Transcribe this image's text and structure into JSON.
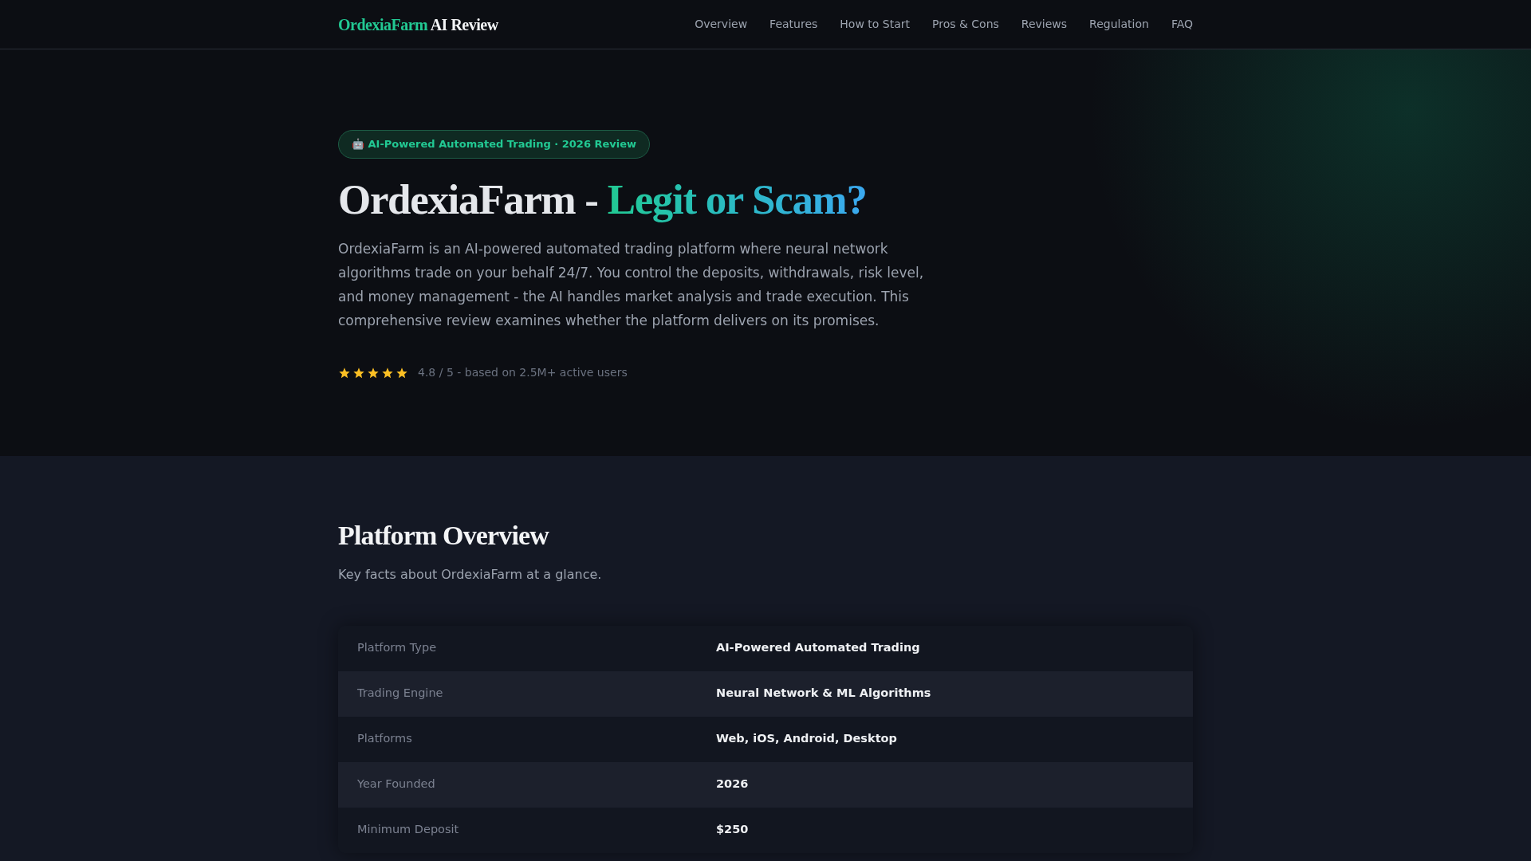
{
  "header": {
    "logo": {
      "brand": "OrdexiaFarm",
      "suffix": "AI Review"
    },
    "nav": [
      "Overview",
      "Features",
      "How to Start",
      "Pros & Cons",
      "Reviews",
      "Regulation",
      "FAQ"
    ]
  },
  "hero": {
    "badge": "🤖 AI-Powered Automated Trading · 2026 Review",
    "title": {
      "main": "OrdexiaFarm -",
      "highlight": "Legit or Scam?"
    },
    "description": "OrdexiaFarm is an AI-powered automated trading platform where neural network algorithms trade on your behalf 24/7. You control the deposits, withdrawals, risk level, and money management - the AI handles market analysis and trade execution. This comprehensive review examines whether the platform delivers on its promises.",
    "rating": {
      "stars": 5,
      "text": "4.8 / 5 - based on 2.5M+ active users"
    }
  },
  "overview": {
    "title": "Platform Overview",
    "subtitle": "Key facts about OrdexiaFarm at a glance.",
    "rows": [
      {
        "label": "Platform Type",
        "value": "AI-Powered Automated Trading"
      },
      {
        "label": "Trading Engine",
        "value": "Neural Network & ML Algorithms"
      },
      {
        "label": "Platforms",
        "value": "Web, iOS, Android, Desktop"
      },
      {
        "label": "Year Founded",
        "value": "2026"
      },
      {
        "label": "Minimum Deposit",
        "value": "$250"
      }
    ]
  }
}
